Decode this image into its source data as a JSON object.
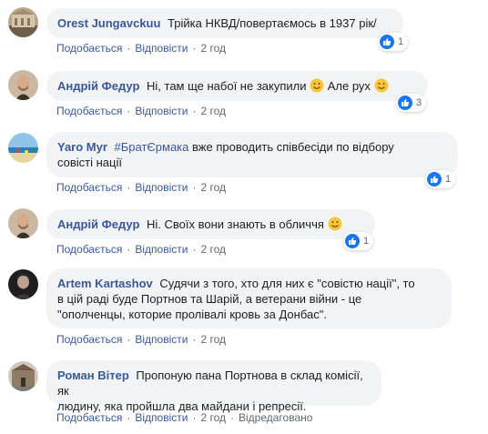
{
  "actions": {
    "like": "Подобається",
    "reply": "Відповісти",
    "edited": "Відредаговано"
  },
  "comments": [
    {
      "author": "Orest Jungavckuu",
      "text": "Трійка НКВД/повертаємось в 1937 рік/",
      "time": "2 год",
      "likes": "1"
    },
    {
      "author": "Андрій Федур",
      "text_before": "Ні, там ще набої не закупили",
      "text_middle": "Але рух",
      "time": "2 год",
      "likes": "3"
    },
    {
      "author": "Yaro Myr",
      "hashtag": "#БратЄрмака",
      "text_line1": "вже проводить співбесіди по відбору",
      "text_line2": "совісті нації",
      "time": "2 год",
      "likes": "1"
    },
    {
      "author": "Андрій Федур",
      "text": "Ні. Своїх вони знають в обличчя",
      "time": "2 год",
      "likes": "1"
    },
    {
      "author": "Artem Kartashov",
      "text_line1": "Судячи з того, хто для них є \"совістю нації\", то",
      "text_line2": "в цій раді буде Портнов та Шарій, а ветерани війни - це",
      "text_line3": "\"ополченцы, которие пролівалі кровь за Донбас\".",
      "time": "2 год"
    },
    {
      "author": "Роман Вітер",
      "text_line1": "Пропоную пана Портнова в склад комісії, як",
      "text_line2": "людину, яка пройшла два майдани і репресії.",
      "time": "2 год"
    }
  ],
  "colors": {
    "author": "#385898",
    "bubble": "#f2f3f5",
    "meta": "#606770",
    "like_blue": "#1877f2"
  }
}
